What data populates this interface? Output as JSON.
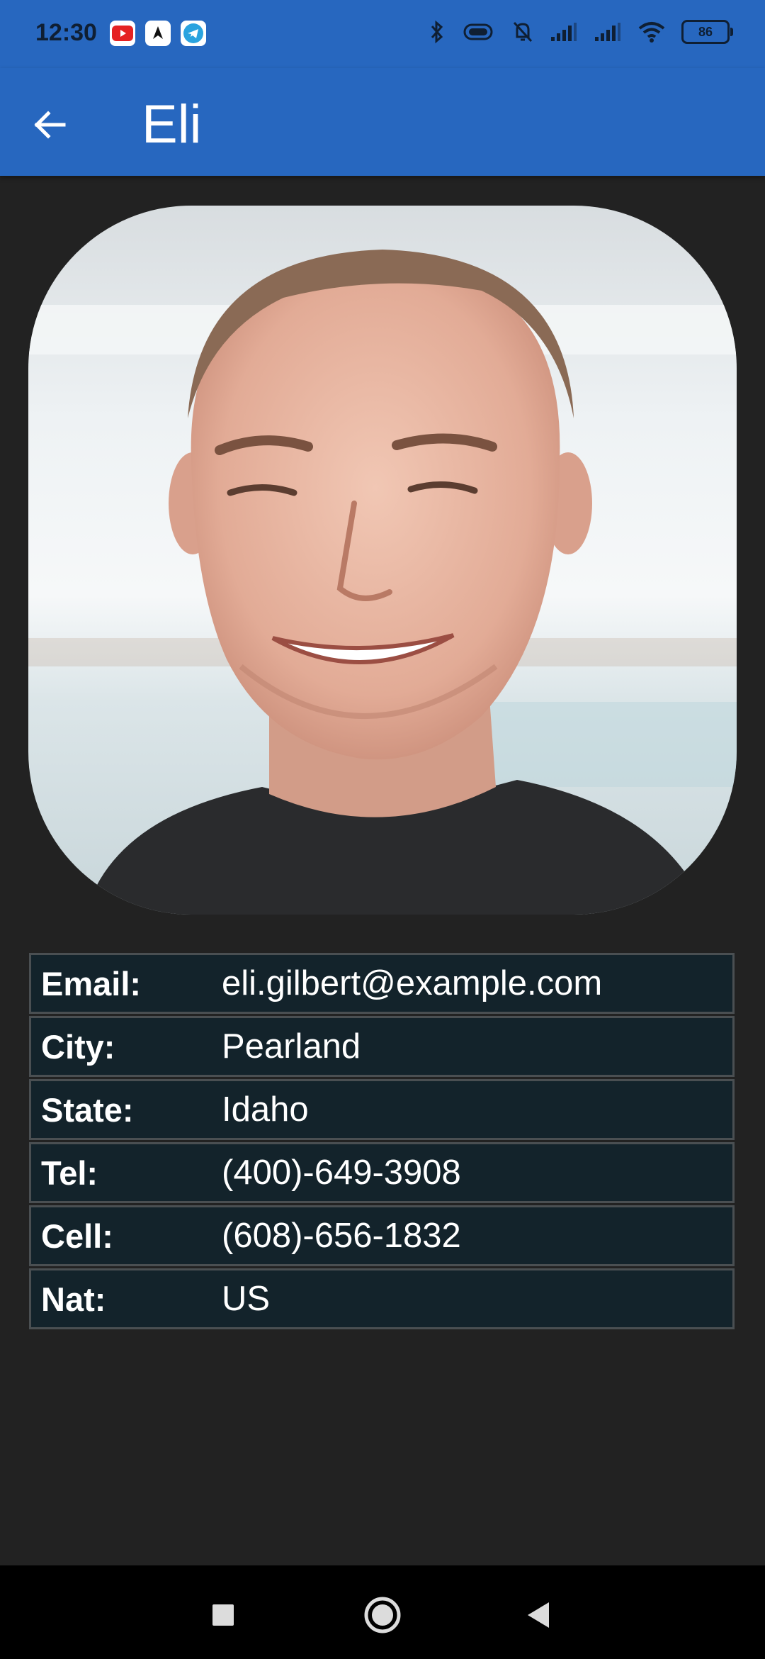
{
  "status_bar": {
    "time": "12:30",
    "battery": "86",
    "icons": [
      "youtube-icon",
      "app-icon",
      "telegram-icon",
      "bluetooth-icon",
      "vibrate-icon",
      "silent-bell-icon",
      "signal-icon",
      "signal-icon",
      "wifi-icon",
      "battery-icon"
    ]
  },
  "app_bar": {
    "title": "Eli",
    "back_icon": "arrow-left-icon"
  },
  "contact": {
    "fields": [
      {
        "label": "Email:",
        "value": "eli.gilbert@example.com"
      },
      {
        "label": "City:",
        "value": "Pearland"
      },
      {
        "label": "State:",
        "value": "Idaho"
      },
      {
        "label": "Tel:",
        "value": "(400)-649-3908"
      },
      {
        "label": "Cell:",
        "value": "(608)-656-1832"
      },
      {
        "label": "Nat:",
        "value": "US"
      }
    ]
  },
  "nav_bar": {
    "icons": [
      "recents-square-icon",
      "home-circle-icon",
      "back-triangle-icon"
    ]
  },
  "colors": {
    "app_bar": "#2767bf",
    "background": "#222222",
    "table_row": "#13232b",
    "table_border": "#4a4f52"
  }
}
